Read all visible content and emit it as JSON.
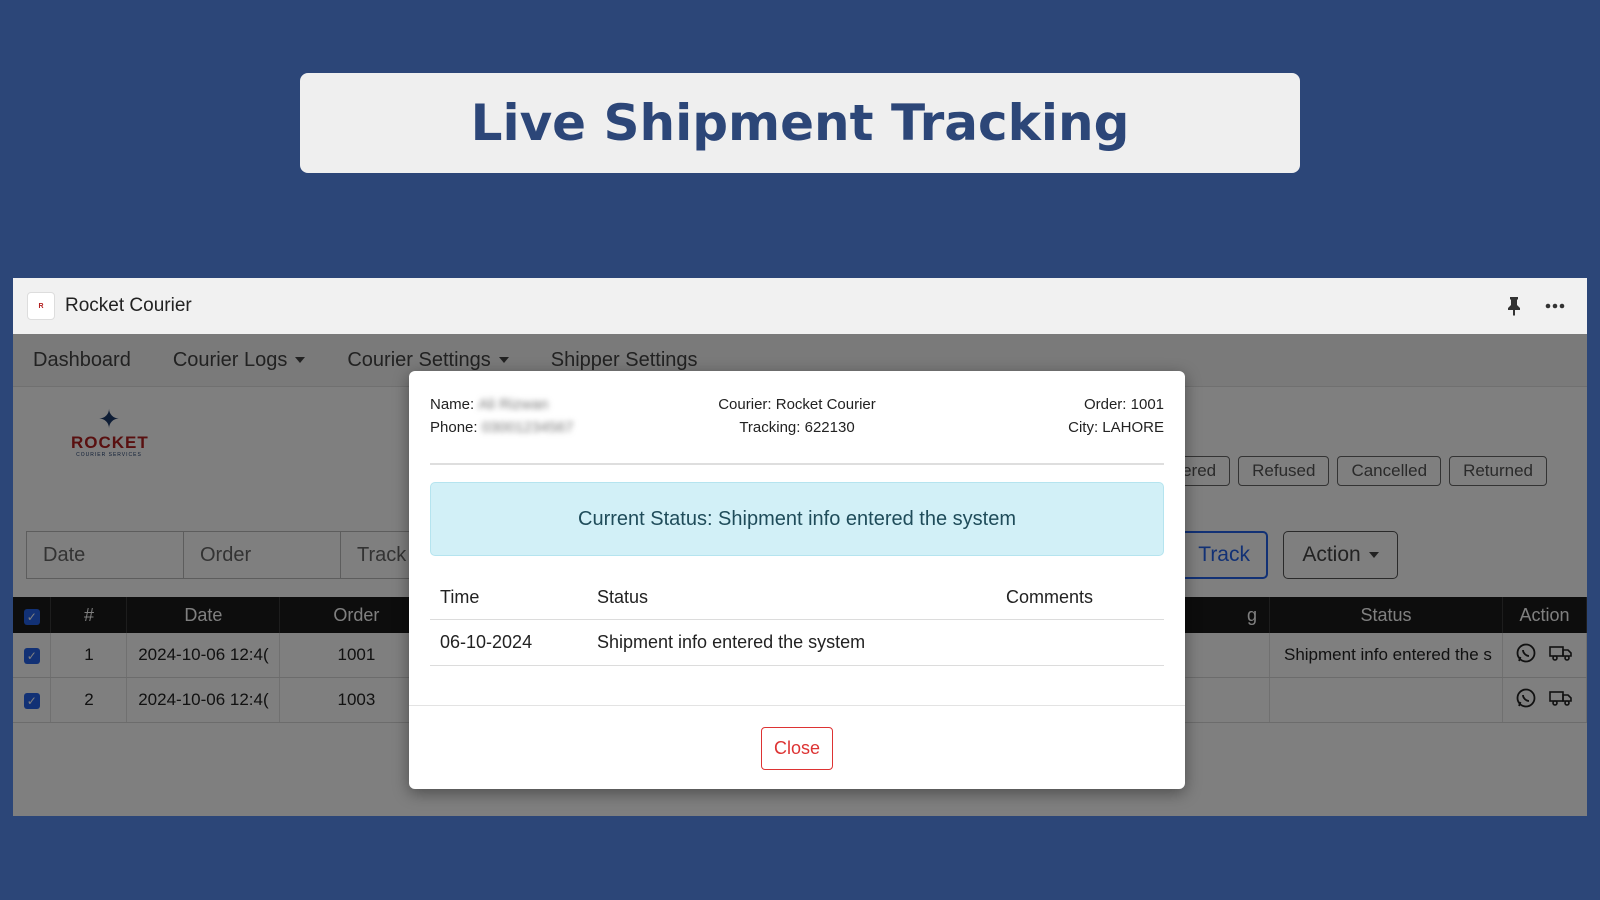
{
  "banner": {
    "title": "Live Shipment Tracking"
  },
  "window": {
    "title": "Rocket Courier"
  },
  "nav": {
    "items": [
      {
        "label": "Dashboard"
      },
      {
        "label": "Courier Logs"
      },
      {
        "label": "Courier Settings"
      },
      {
        "label": "Shipper Settings"
      }
    ]
  },
  "logo": {
    "word": "ROCKET",
    "sub": "COURIER SERVICES"
  },
  "filters": [
    "vered",
    "Refused",
    "Cancelled",
    "Returned"
  ],
  "search": {
    "fields": [
      "Date",
      "Order",
      "Track"
    ],
    "track_button": "Track",
    "action_button": "Action"
  },
  "table": {
    "headers": [
      "#",
      "Date",
      "Order",
      "g",
      "Status",
      "Action"
    ],
    "rows": [
      {
        "num": "1",
        "date": "2024-10-06 12:4(",
        "order": "1001",
        "status": "Shipment info entered the s"
      },
      {
        "num": "2",
        "date": "2024-10-06 12:4(",
        "order": "1003",
        "status": ""
      }
    ]
  },
  "modal": {
    "name_label": "Name:",
    "name_value": "Ali Rizwan",
    "phone_label": "Phone:",
    "phone_value": "03001234567",
    "courier": "Courier: Rocket Courier",
    "tracking": "Tracking: 622130",
    "order": "Order: 1001",
    "city": "City: LAHORE",
    "current_status": "Current Status: Shipment info entered the system",
    "history_headers": {
      "time": "Time",
      "status": "Status",
      "comments": "Comments"
    },
    "history_rows": [
      {
        "time": "06-10-2024",
        "status": "Shipment info entered the system",
        "comments": ""
      }
    ],
    "close_label": "Close"
  },
  "colors": {
    "background": "#2c4678",
    "accent": "#2563eb",
    "close_red": "#dd3333",
    "alert_bg": "#d2f0f7"
  }
}
